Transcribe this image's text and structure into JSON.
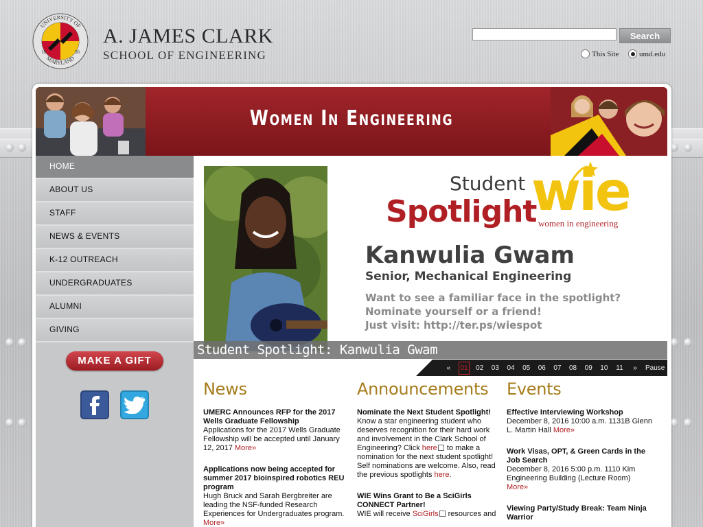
{
  "seal": {
    "top": "UNIVERSITY OF",
    "bottom": "MARYLAND",
    "year_left": "18",
    "year_right": "56"
  },
  "header": {
    "brand_line1": "A. JAMES CLARK",
    "brand_line2": "SCHOOL OF ENGINEERING",
    "search_button": "Search",
    "scope_this_site": "This Site",
    "scope_umd": "umd.edu"
  },
  "banner": {
    "title": "Women In Engineering"
  },
  "sidebar": {
    "items": [
      {
        "label": "HOME"
      },
      {
        "label": "ABOUT US"
      },
      {
        "label": "STAFF"
      },
      {
        "label": "NEWS & EVENTS"
      },
      {
        "label": "K-12 OUTREACH"
      },
      {
        "label": "UNDERGRADUATES"
      },
      {
        "label": "ALUMNI"
      },
      {
        "label": "GIVING"
      }
    ],
    "gift_button": "MAKE A GIFT"
  },
  "feature": {
    "student": "Student",
    "spotlight": "Spotlight",
    "wie": "wie",
    "wie_sub": "women in engineering",
    "name": "Kanwulia Gwam",
    "role": "Senior, Mechanical Engineering",
    "line1": "Want to see a familiar face in the spotlight?",
    "line2": "Nominate yourself or a friend!",
    "line3": "Just visit: http://ter.ps/wiespot",
    "caption": "Student Spotlight: Kanwulia Gwam"
  },
  "pager": {
    "prev": "«",
    "pages": [
      "01",
      "02",
      "03",
      "04",
      "05",
      "06",
      "07",
      "08",
      "09",
      "10",
      "11"
    ],
    "current": "01",
    "next": "»",
    "pause": "Pause"
  },
  "news": {
    "heading": "News",
    "items": [
      {
        "title": "UMERC Announces RFP for the 2017 Wells Graduate Fellowship",
        "body": "Applications for the 2017 Wells Graduate Fellowship will be accepted until January 12, 2017",
        "more": "More»"
      },
      {
        "title": "Applications now being accepted for summer 2017 bioinspired robotics REU program",
        "body": "Hugh Bruck and Sarah Bergbreiter are leading the NSF-funded Research Experiences for Undergraduates program.",
        "more": "More»"
      }
    ]
  },
  "announcements": {
    "heading": "Announcements",
    "items": [
      {
        "title": "Nominate the Next Student Spotlight!",
        "body1": "Know a star engineering student who deserves recognition for their hard work and involvement in the Clark School of Engineering? Click",
        "link1": "here",
        "body2": "to make a nomination for the next student spotlight! Self nominations are welcome. Also, read the previous spotlights",
        "link2": "here",
        "end": "."
      },
      {
        "title": "WIE Wins Grant to Be a SciGirls CONNECT Partner!",
        "body1": "WIE will receive",
        "link1": "SciGirls",
        "body2": "resources and"
      }
    ]
  },
  "events": {
    "heading": "Events",
    "items": [
      {
        "title": "Effective Interviewing Workshop",
        "body": "December 8, 2016 10:00 a.m. 1131B Glenn L. Martin Hall",
        "more": "More»"
      },
      {
        "title": "Work Visas, OPT, & Green Cards in the Job Search",
        "body": "December 8, 2016 5:00 p.m. 1110 Kim Engineering Building (Lecture Room)",
        "more": "More»"
      },
      {
        "title": "Viewing Party/Study Break: Team Ninja Warrior",
        "body": "",
        "more": ""
      }
    ]
  },
  "colors": {
    "umd_red": "#b01f24",
    "gold": "#a57c1b",
    "wie_yellow": "#f2c30f"
  }
}
